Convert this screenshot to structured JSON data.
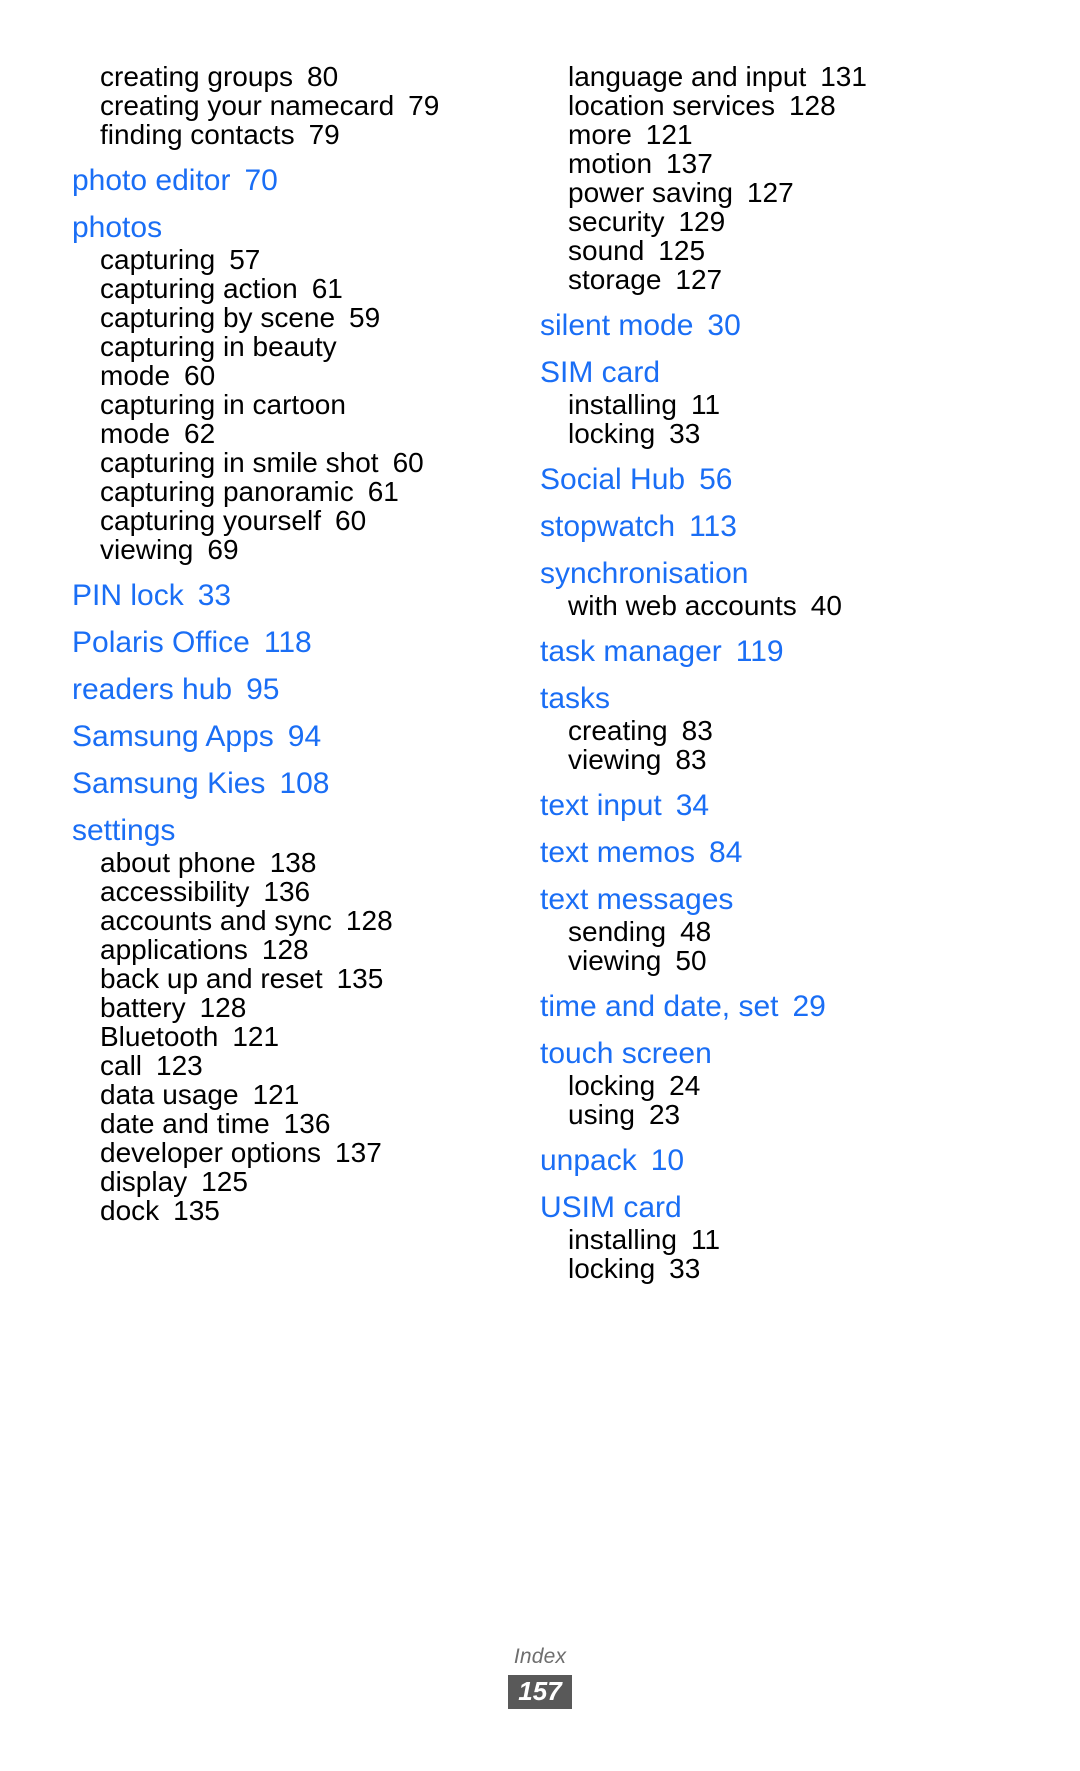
{
  "page": {
    "footer_label": "Index",
    "page_number": "157",
    "accent_color": "#1a6ef5",
    "text_color": "#000000",
    "footer_color": "#6e6e6e",
    "footer_badge_color": "#595959"
  },
  "columns": [
    {
      "name": "left",
      "entries": [
        {
          "kind": "sub",
          "label": "creating groups",
          "page": "80"
        },
        {
          "kind": "sub",
          "label": "creating your namecard",
          "page": "79"
        },
        {
          "kind": "sub",
          "label": "finding contacts",
          "page": "79"
        },
        {
          "kind": "head",
          "label": "photo editor",
          "page": "70"
        },
        {
          "kind": "head",
          "label": "photos",
          "page": ""
        },
        {
          "kind": "sub",
          "label": "capturing",
          "page": "57"
        },
        {
          "kind": "sub",
          "label": "capturing action",
          "page": "61"
        },
        {
          "kind": "sub",
          "label": "capturing by scene",
          "page": "59"
        },
        {
          "kind": "sub",
          "label": "capturing in beauty",
          "page": ""
        },
        {
          "kind": "sub",
          "label": "mode",
          "page": "60"
        },
        {
          "kind": "sub",
          "label": "capturing in cartoon",
          "page": ""
        },
        {
          "kind": "sub",
          "label": "mode",
          "page": "62"
        },
        {
          "kind": "sub",
          "label": "capturing in smile shot",
          "page": "60"
        },
        {
          "kind": "sub",
          "label": "capturing panoramic",
          "page": "61"
        },
        {
          "kind": "sub",
          "label": "capturing yourself",
          "page": "60"
        },
        {
          "kind": "sub",
          "label": "viewing",
          "page": "69"
        },
        {
          "kind": "head",
          "label": "PIN lock",
          "page": "33"
        },
        {
          "kind": "head",
          "label": "Polaris Office",
          "page": "118"
        },
        {
          "kind": "head",
          "label": "readers hub",
          "page": "95"
        },
        {
          "kind": "head",
          "label": "Samsung Apps",
          "page": "94"
        },
        {
          "kind": "head",
          "label": "Samsung Kies",
          "page": "108"
        },
        {
          "kind": "head",
          "label": "settings",
          "page": ""
        },
        {
          "kind": "sub",
          "label": "about phone",
          "page": "138"
        },
        {
          "kind": "sub",
          "label": "accessibility",
          "page": "136"
        },
        {
          "kind": "sub",
          "label": "accounts and sync",
          "page": "128"
        },
        {
          "kind": "sub",
          "label": "applications",
          "page": "128"
        },
        {
          "kind": "sub",
          "label": "back up and reset",
          "page": "135"
        },
        {
          "kind": "sub",
          "label": "battery",
          "page": "128"
        },
        {
          "kind": "sub",
          "label": "Bluetooth",
          "page": "121"
        },
        {
          "kind": "sub",
          "label": "call",
          "page": "123"
        },
        {
          "kind": "sub",
          "label": "data usage",
          "page": "121"
        },
        {
          "kind": "sub",
          "label": "date and time",
          "page": "136"
        },
        {
          "kind": "sub",
          "label": "developer options",
          "page": "137"
        },
        {
          "kind": "sub",
          "label": "display",
          "page": "125"
        },
        {
          "kind": "sub",
          "label": "dock",
          "page": "135"
        }
      ]
    },
    {
      "name": "right",
      "entries": [
        {
          "kind": "sub",
          "label": "language and input",
          "page": "131"
        },
        {
          "kind": "sub",
          "label": "location services",
          "page": "128"
        },
        {
          "kind": "sub",
          "label": "more",
          "page": "121"
        },
        {
          "kind": "sub",
          "label": "motion",
          "page": "137"
        },
        {
          "kind": "sub",
          "label": "power saving",
          "page": "127"
        },
        {
          "kind": "sub",
          "label": "security",
          "page": "129"
        },
        {
          "kind": "sub",
          "label": "sound",
          "page": "125"
        },
        {
          "kind": "sub",
          "label": "storage",
          "page": "127"
        },
        {
          "kind": "head",
          "label": "silent mode",
          "page": "30"
        },
        {
          "kind": "head",
          "label": "SIM card",
          "page": ""
        },
        {
          "kind": "sub",
          "label": "installing",
          "page": "11"
        },
        {
          "kind": "sub",
          "label": "locking",
          "page": "33"
        },
        {
          "kind": "head",
          "label": "Social Hub",
          "page": "56"
        },
        {
          "kind": "head",
          "label": "stopwatch",
          "page": "113"
        },
        {
          "kind": "head",
          "label": "synchronisation",
          "page": ""
        },
        {
          "kind": "sub",
          "label": "with web accounts",
          "page": "40"
        },
        {
          "kind": "head",
          "label": "task manager",
          "page": "119"
        },
        {
          "kind": "head",
          "label": "tasks",
          "page": ""
        },
        {
          "kind": "sub",
          "label": "creating",
          "page": "83"
        },
        {
          "kind": "sub",
          "label": "viewing",
          "page": "83"
        },
        {
          "kind": "head",
          "label": "text input",
          "page": "34"
        },
        {
          "kind": "head",
          "label": "text memos",
          "page": "84"
        },
        {
          "kind": "head",
          "label": "text messages",
          "page": ""
        },
        {
          "kind": "sub",
          "label": "sending",
          "page": "48"
        },
        {
          "kind": "sub",
          "label": "viewing",
          "page": "50"
        },
        {
          "kind": "head",
          "label": "time and date, set",
          "page": "29"
        },
        {
          "kind": "head",
          "label": "touch screen",
          "page": ""
        },
        {
          "kind": "sub",
          "label": "locking",
          "page": "24"
        },
        {
          "kind": "sub",
          "label": "using",
          "page": "23"
        },
        {
          "kind": "head",
          "label": "unpack",
          "page": "10"
        },
        {
          "kind": "head",
          "label": "USIM card",
          "page": ""
        },
        {
          "kind": "sub",
          "label": "installing",
          "page": "11"
        },
        {
          "kind": "sub",
          "label": "locking",
          "page": "33"
        }
      ]
    }
  ]
}
